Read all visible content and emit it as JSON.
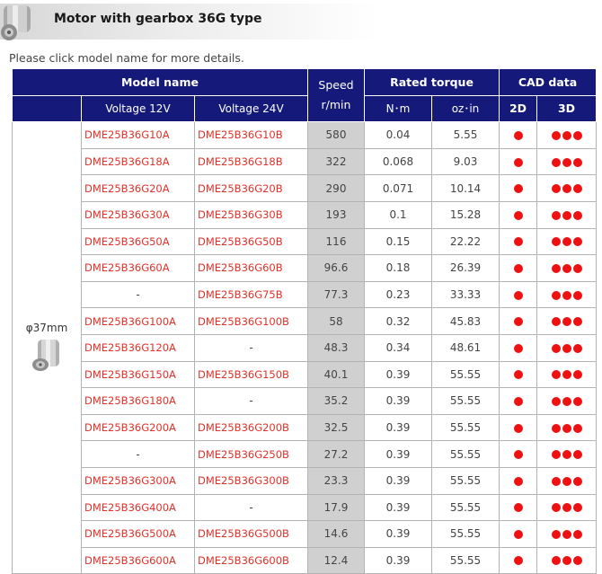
{
  "header": {
    "title": "Motor with gearbox 36G type"
  },
  "note": "Please click model name for more details.",
  "table": {
    "headers": {
      "model_name": "Model name",
      "speed": "Speed",
      "speed_unit": "r/min",
      "rated_torque": "Rated torque",
      "cad_data": "CAD data",
      "voltage_12": "Voltage 12V",
      "voltage_24": "Voltage 24V",
      "nm": "N･m",
      "ozin": "oz･in",
      "cad_2d": "2D",
      "cad_3d": "3D"
    },
    "size_label": "φ37mm",
    "rows": [
      {
        "v12": "DME25B36G10A",
        "v24": "DME25B36G10B",
        "speed": "580",
        "nm": "0.04",
        "ozin": "5.55"
      },
      {
        "v12": "DME25B36G18A",
        "v24": "DME25B36G18B",
        "speed": "322",
        "nm": "0.068",
        "ozin": "9.03"
      },
      {
        "v12": "DME25B36G20A",
        "v24": "DME25B36G20B",
        "speed": "290",
        "nm": "0.071",
        "ozin": "10.14"
      },
      {
        "v12": "DME25B36G30A",
        "v24": "DME25B36G30B",
        "speed": "193",
        "nm": "0.1",
        "ozin": "15.28"
      },
      {
        "v12": "DME25B36G50A",
        "v24": "DME25B36G50B",
        "speed": "116",
        "nm": "0.15",
        "ozin": "22.22"
      },
      {
        "v12": "DME25B36G60A",
        "v24": "DME25B36G60B",
        "speed": "96.6",
        "nm": "0.18",
        "ozin": "26.39"
      },
      {
        "v12": "-",
        "v24": "DME25B36G75B",
        "speed": "77.3",
        "nm": "0.23",
        "ozin": "33.33"
      },
      {
        "v12": "DME25B36G100A",
        "v24": "DME25B36G100B",
        "speed": "58",
        "nm": "0.32",
        "ozin": "45.83"
      },
      {
        "v12": "DME25B36G120A",
        "v24": "-",
        "speed": "48.3",
        "nm": "0.34",
        "ozin": "48.61"
      },
      {
        "v12": "DME25B36G150A",
        "v24": "DME25B36G150B",
        "speed": "40.1",
        "nm": "0.39",
        "ozin": "55.55"
      },
      {
        "v12": "DME25B36G180A",
        "v24": "-",
        "speed": "35.2",
        "nm": "0.39",
        "ozin": "55.55"
      },
      {
        "v12": "DME25B36G200A",
        "v24": "DME25B36G200B",
        "speed": "32.5",
        "nm": "0.39",
        "ozin": "55.55"
      },
      {
        "v12": "-",
        "v24": "DME25B36G250B",
        "speed": "27.2",
        "nm": "0.39",
        "ozin": "55.55"
      },
      {
        "v12": "DME25B36G300A",
        "v24": "DME25B36G300B",
        "speed": "23.3",
        "nm": "0.39",
        "ozin": "55.55"
      },
      {
        "v12": "DME25B36G400A",
        "v24": "-",
        "speed": "17.9",
        "nm": "0.39",
        "ozin": "55.55"
      },
      {
        "v12": "DME25B36G500A",
        "v24": "DME25B36G500B",
        "speed": "14.6",
        "nm": "0.39",
        "ozin": "55.55"
      },
      {
        "v12": "DME25B36G600A",
        "v24": "DME25B36G600B",
        "speed": "12.4",
        "nm": "0.39",
        "ozin": "55.55"
      }
    ],
    "dot_color": "#ee1111",
    "header_color": "#151a7a",
    "link_color": "#e0322a"
  }
}
